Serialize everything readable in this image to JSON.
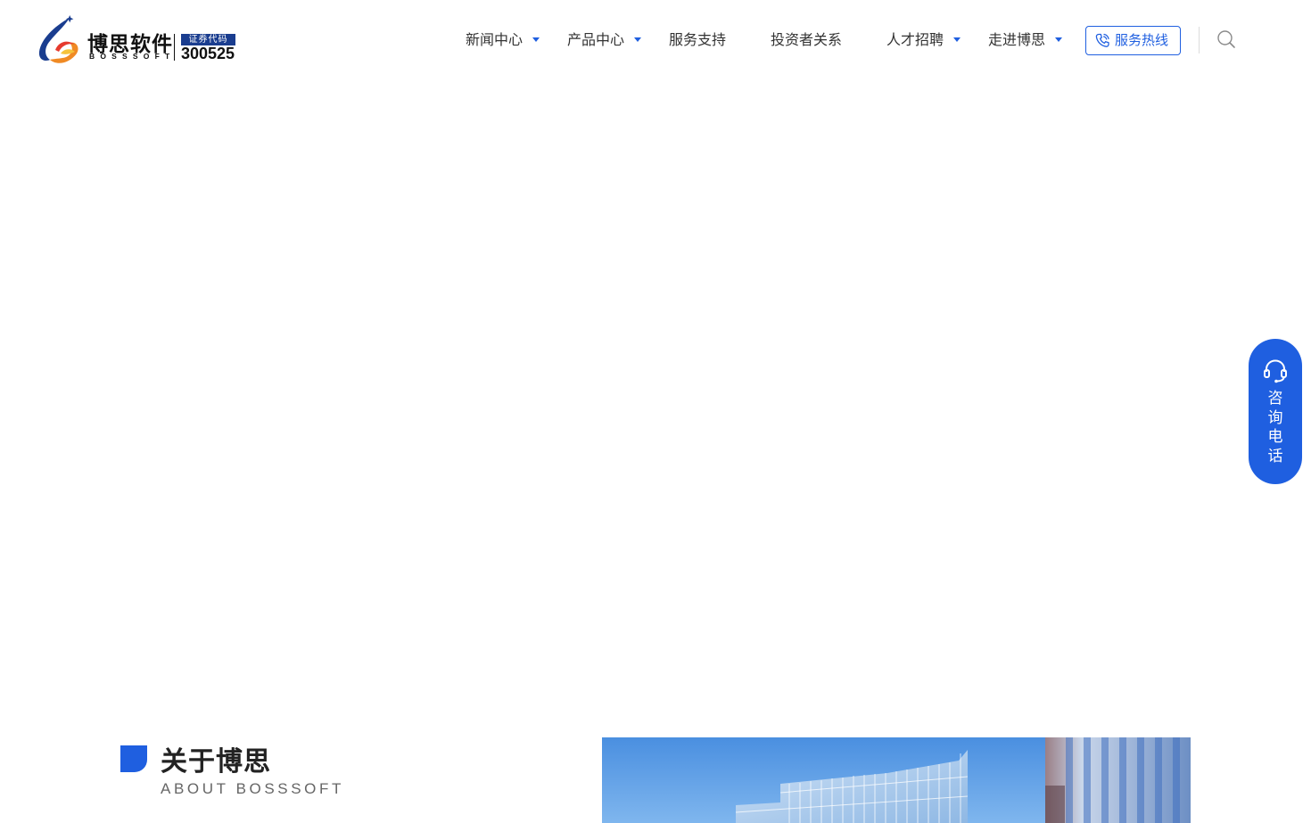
{
  "logo": {
    "cn": "博思软件",
    "en": "BOSSSOFT",
    "stock_label": "证券代码",
    "stock_code": "300525"
  },
  "nav": {
    "items": [
      {
        "label": "新闻中心",
        "has_dropdown": true
      },
      {
        "label": "产品中心",
        "has_dropdown": true
      },
      {
        "label": "服务支持",
        "has_dropdown": false
      },
      {
        "label": "投资者关系",
        "has_dropdown": false
      },
      {
        "label": "人才招聘",
        "has_dropdown": true
      },
      {
        "label": "走进博思",
        "has_dropdown": true
      }
    ],
    "hotline_label": "服务热线"
  },
  "consult": {
    "label_lines": [
      "咨",
      "询",
      "电",
      "话"
    ]
  },
  "about": {
    "title": "关于博思",
    "subtitle": "ABOUT BOSSSOFT"
  },
  "colors": {
    "accent": "#1f5fe0",
    "stock_badge": "#1a3d8f",
    "text": "#333333"
  },
  "icons": {
    "hotline": "phone-icon",
    "search": "search-icon",
    "consult": "headset-icon",
    "nav_dropdown": "caret-down-icon"
  }
}
